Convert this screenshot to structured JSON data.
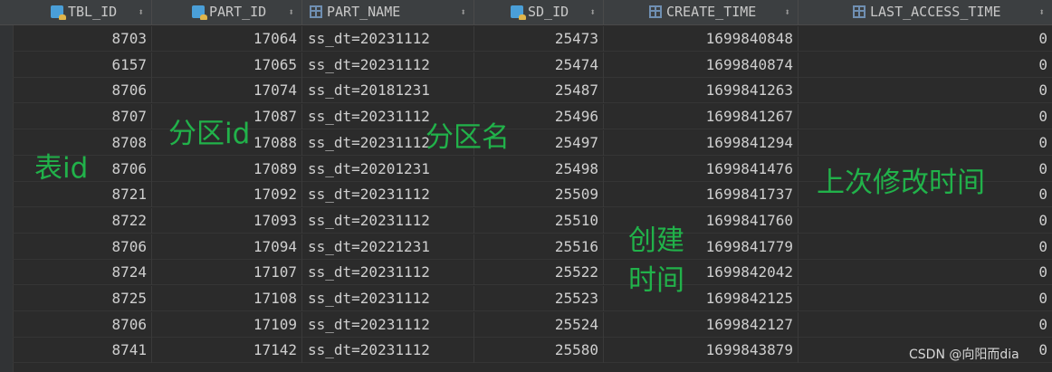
{
  "columns": [
    {
      "label": "TBL_ID",
      "icon": "key-column-icon",
      "sort_icon": "sort-arrows-icon"
    },
    {
      "label": "PART_ID",
      "icon": "key-column-icon",
      "sort_icon": "sort-arrows-icon"
    },
    {
      "label": "PART_NAME",
      "icon": "column-icon",
      "sort_icon": "sort-arrows-icon"
    },
    {
      "label": "SD_ID",
      "icon": "key-column-icon",
      "sort_icon": "sort-arrows-icon"
    },
    {
      "label": "CREATE_TIME",
      "icon": "column-icon",
      "sort_icon": "sort-arrows-icon"
    },
    {
      "label": "LAST_ACCESS_TIME",
      "icon": "column-icon",
      "sort_icon": "sort-arrows-icon"
    }
  ],
  "sort_glyph": "⬍",
  "rows": [
    [
      "8703",
      "17064",
      "ss_dt=20231112",
      "25473",
      "1699840848",
      "0"
    ],
    [
      "6157",
      "17065",
      "ss_dt=20231112",
      "25474",
      "1699840874",
      "0"
    ],
    [
      "8706",
      "17074",
      "ss_dt=20181231",
      "25487",
      "1699841263",
      "0"
    ],
    [
      "8707",
      "17087",
      "ss_dt=20231112",
      "25496",
      "1699841267",
      "0"
    ],
    [
      "8708",
      "17088",
      "ss_dt=20231112",
      "25497",
      "1699841294",
      "0"
    ],
    [
      "8706",
      "17089",
      "ss_dt=20201231",
      "25498",
      "1699841476",
      "0"
    ],
    [
      "8721",
      "17092",
      "ss_dt=20231112",
      "25509",
      "1699841737",
      "0"
    ],
    [
      "8722",
      "17093",
      "ss_dt=20231112",
      "25510",
      "1699841760",
      "0"
    ],
    [
      "8706",
      "17094",
      "ss_dt=20221231",
      "25516",
      "1699841779",
      "0"
    ],
    [
      "8724",
      "17107",
      "ss_dt=20231112",
      "25522",
      "1699842042",
      "0"
    ],
    [
      "8725",
      "17108",
      "ss_dt=20231112",
      "25523",
      "1699842125",
      "0"
    ],
    [
      "8706",
      "17109",
      "ss_dt=20231112",
      "25524",
      "1699842127",
      "0"
    ],
    [
      "8741",
      "17142",
      "ss_dt=20231112",
      "25580",
      "1699843879",
      "0"
    ]
  ],
  "annotations": {
    "table_id": "表id",
    "partition_id": "分区id",
    "partition_name": "分区名",
    "create_time_line1": "创建",
    "create_time_line2": "时间",
    "last_modify_time": "上次修改时间"
  },
  "colors": {
    "annotation": "#21b24a",
    "background": "#2b2b2b",
    "header": "#3c3f41"
  },
  "watermark": "CSDN @向阳而dia"
}
